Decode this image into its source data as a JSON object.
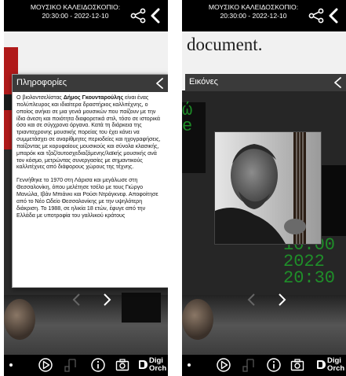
{
  "header": {
    "title_line1": "ΜΟΥΣΙΚΟ ΚΑΛΕΙΔΟΣΚΟΠΙΟ:",
    "title_line2": "20:30:00 - 2022-12-10"
  },
  "info_dialog": {
    "title": "Πληροφορίες",
    "p1_prefix": "Ο βιολοντσελίστας ",
    "p1_name": "Δήμος Γκουνταρούλης",
    "p1_rest": " είναι ένας πολύπλευρος και ιδιαίτερα δραστήριος καλλιτέχνης, ο οποίος ανήκει σε μια γενιά μουσικών που παίζουν με την ίδια άνεση και ποιότητα διαφορετικά στιλ, τόσο σε ιστορικά όσο και σε σύγχρονα όργανα. Κατά τη διάρκεια της τριανταχρονης μουσικής πορείας του έχει κάνει να συμμετάσχει σε αναρίθμητες περιοδείες και ηχογραφήσεις, παίζοντας με κορυφαίους μουσικούς και σύνολα κλασικής, μπαρόκ και τζαζ/αυτοσχεδιαζόμενης/λαϊκής μουσικής ανά τον κόσμο, μετρώντας συνεργασίες με σημαντικούς καλλιτέχνες από διάφορους χώρους της τέχνης.",
    "p2": "Γεννήθηκε το 1970 στη Λάρισα και μεγάλωσε στη Θεσσαλονίκη, όπου μελέτησε τσέλο με τους Γιώργο Μανώλα, Ιβάν Μπιάνκι και Ρούσι Ντράγκνεφ. Αποφοίτησε από το Νέο Ωδείο Θεσσαλονίκης με την υψηλότερη διάκριση. Το 1988, σε ηλικία 18 ετών, έφυγε από την Ελλάδα με υποτροφία του γαλλικού κράτους"
  },
  "images_dialog": {
    "title": "Εικόνες"
  },
  "background": {
    "document_text": "document.",
    "green_text": [
      "10:00",
      "2022",
      "20:30"
    ],
    "green_partial": [
      "ώ",
      "e"
    ]
  },
  "bottom_bar": {
    "brand_line1": "Digi",
    "brand_line2": "Orch"
  },
  "colors": {
    "dialog_header": "#3a3a3a",
    "top_bar": "#000000",
    "accent_green": "#1f9a2a"
  },
  "icons": [
    "share-icon",
    "back-chevron-icon",
    "close-chevron-icon",
    "prev-arrow-icon",
    "next-arrow-icon",
    "play-circle-icon",
    "music-note-icon",
    "info-circle-icon",
    "camera-icon",
    "digiorch-logo"
  ]
}
